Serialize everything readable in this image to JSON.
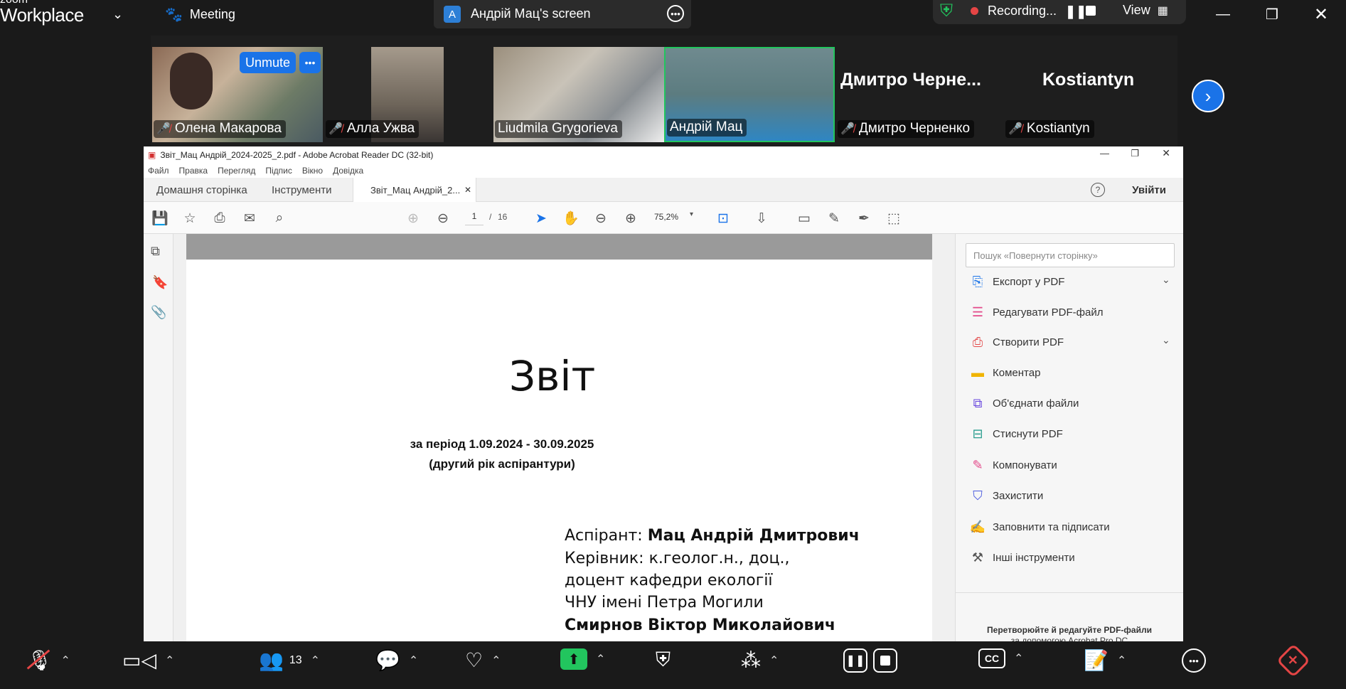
{
  "zoom": {
    "brand_small": "zoom",
    "brand": "Workplace",
    "meeting_label": "Meeting",
    "screen_badge": "A",
    "screen_label": "Андрій Мац's screen",
    "recording_label": "Recording...",
    "view_label": "View"
  },
  "gallery": {
    "unmute_label": "Unmute",
    "tiles": [
      {
        "name": "Олена Макарова"
      },
      {
        "name": "Алла Ужва"
      },
      {
        "name": "Liudmila Grygorieva"
      },
      {
        "name": "Андрій Мац"
      },
      {
        "name": "Дмитро Черненко",
        "plate": "Дмитро  Черне..."
      },
      {
        "name": "Kostiantyn",
        "plate": "Kostiantyn"
      }
    ]
  },
  "acrobat": {
    "title": "Звіт_Мац Андрій_2024-2025_2.pdf - Adobe Acrobat Reader DC (32-bit)",
    "menu": [
      "Файл",
      "Правка",
      "Перегляд",
      "Підпис",
      "Вікно",
      "Довідка"
    ],
    "tabs": {
      "home": "Домашня сторінка",
      "tools": "Інструменти",
      "doc": "Звіт_Мац Андрій_2..."
    },
    "signin": "Увійти",
    "page_current": "1",
    "page_sep": "/",
    "page_total": "16",
    "zoom": "75,2%",
    "search_placeholder": "Пошук «Повернути сторінку»",
    "tools": [
      {
        "label": "Експорт у PDF",
        "icon": "export-pdf-icon",
        "color": "#1a73e8"
      },
      {
        "label": "Редагувати PDF-файл",
        "icon": "edit-pdf-icon",
        "color": "#e34a8a"
      },
      {
        "label": "Створити PDF",
        "icon": "create-pdf-icon",
        "color": "#e34a4a"
      },
      {
        "label": "Коментар",
        "icon": "comment-icon",
        "color": "#f0b400"
      },
      {
        "label": "Об'єднати файли",
        "icon": "combine-icon",
        "color": "#6b4adf"
      },
      {
        "label": "Стиснути PDF",
        "icon": "compress-icon",
        "color": "#2a9d8f"
      },
      {
        "label": "Компонувати",
        "icon": "organize-icon",
        "color": "#e34a8a"
      },
      {
        "label": "Захистити",
        "icon": "protect-icon",
        "color": "#4a5adf"
      },
      {
        "label": "Заповнити та підписати",
        "icon": "fill-sign-icon",
        "color": "#a24adf"
      },
      {
        "label": "Інші інструменти",
        "icon": "more-tools-icon",
        "color": "#555555"
      }
    ],
    "promo_line1": "Перетворюйте й редагуйте PDF-файли",
    "promo_line2": "за допомогою Acrobat Pro DC"
  },
  "document": {
    "title": "Звіт",
    "period": "за період 1.09.2024 - 30.09.2025",
    "year": "(другий рік аспірантури)",
    "student_label": "Аспірант: ",
    "student_name": "Мац Андрій Дмитрович",
    "advisor_line1": "Керівник: к.геолог.н., доц.,",
    "advisor_line2": "доцент кафедри екології",
    "advisor_line3": "ЧНУ імені Петра Могили",
    "advisor_name": "Смирнов Віктор Миколайович"
  },
  "bottom": {
    "participants_count": "13"
  }
}
